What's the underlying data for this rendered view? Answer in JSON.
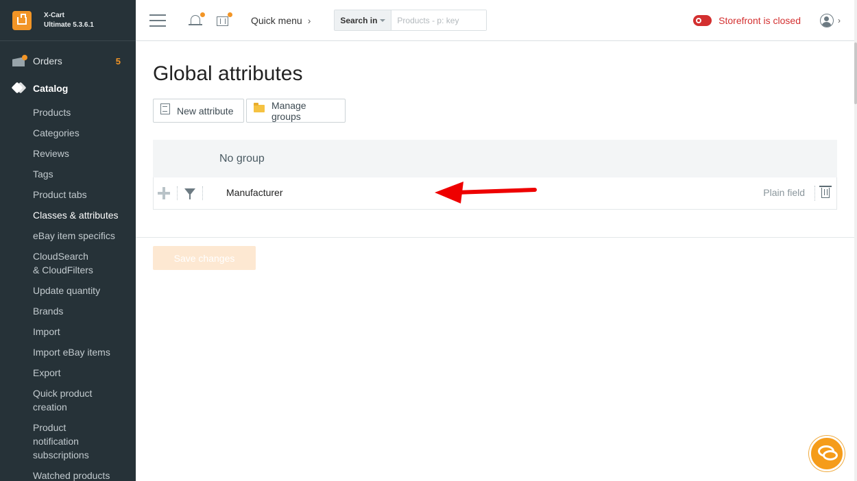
{
  "brand": {
    "name": "X-Cart",
    "edition": "Ultimate 5.3.6.1"
  },
  "sidebar": {
    "orders": {
      "label": "Orders",
      "count": "5"
    },
    "catalog": {
      "label": "Catalog"
    },
    "items": [
      {
        "label": "Products"
      },
      {
        "label": "Categories"
      },
      {
        "label": "Reviews"
      },
      {
        "label": "Tags"
      },
      {
        "label": "Product tabs"
      },
      {
        "label": "Classes & attributes",
        "active": true
      },
      {
        "label": "eBay item specifics"
      },
      {
        "label": "CloudSearch & CloudFilters"
      },
      {
        "label": "Update quantity"
      },
      {
        "label": "Brands"
      },
      {
        "label": "Import"
      },
      {
        "label": "Import eBay items"
      },
      {
        "label": "Export"
      },
      {
        "label": "Quick product creation"
      },
      {
        "label": "Product notification subscriptions"
      },
      {
        "label": "Watched products"
      }
    ]
  },
  "header": {
    "quick_menu": "Quick menu",
    "search": {
      "scope_label": "Search in",
      "placeholder": "Products - p: key",
      "value": ""
    },
    "storefront_status": "Storefront is closed"
  },
  "main": {
    "title": "Global attributes",
    "buttons": {
      "new_attribute": "New attribute",
      "manage_groups": "Manage groups"
    },
    "group": {
      "name": "No group"
    },
    "attribute": {
      "name": "Manufacturer",
      "type": "Plain field"
    },
    "save_label": "Save changes"
  },
  "colors": {
    "sidebar_bg": "#263238",
    "accent": "#f29526",
    "danger": "#d32f2f",
    "arrow": "#ee0000"
  }
}
